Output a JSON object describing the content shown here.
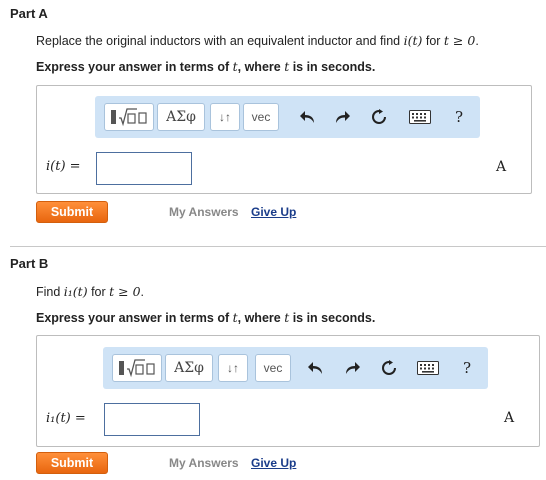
{
  "part_a": {
    "title": "Part A",
    "instruction_pre": "Replace the original inductors with an equivalent inductor and find ",
    "instruction_math_1": "i(t)",
    "instruction_mid": " for ",
    "instruction_math_2": "t ≥ 0",
    "instruction_end": ".",
    "express_pre": "Express your answer in terms of ",
    "express_var1": "t",
    "express_mid": ", where ",
    "express_var2": "t",
    "express_end": " is in seconds.",
    "input_label": "i(t) =",
    "input_value": "",
    "unit": "A",
    "submit_label": "Submit",
    "my_answers_label": "My Answers",
    "give_up_label": "Give Up"
  },
  "part_b": {
    "title": "Part B",
    "instruction_pre": "Find ",
    "instruction_math_1": "i₁(t)",
    "instruction_mid": " for ",
    "instruction_math_2": "t ≥ 0",
    "instruction_end": ".",
    "express_pre": "Express your answer in terms of ",
    "express_var1": "t",
    "express_mid": ", where ",
    "express_var2": "t",
    "express_end": " is in seconds.",
    "input_label": "i₁(t) =",
    "input_value": "",
    "unit": "A",
    "submit_label": "Submit",
    "my_answers_label": "My Answers",
    "give_up_label": "Give Up"
  },
  "toolbar": {
    "template_icon": "templates-icon",
    "greek_label": "ΑΣφ",
    "arrows_label": "↓↑",
    "vec_label": "vec",
    "undo_icon": "undo-icon",
    "redo_icon": "redo-icon",
    "reset_icon": "reset-icon",
    "keyboard_icon": "keyboard-icon",
    "help_label": "?"
  },
  "colors": {
    "toolbar_bg": "#cfe3f6",
    "submit_orange": "#f07a1e",
    "link_blue": "#1a3c8a"
  }
}
